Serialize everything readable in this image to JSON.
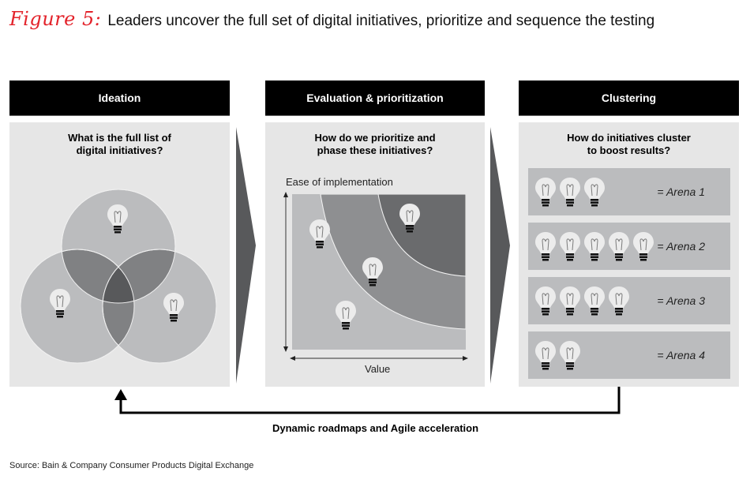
{
  "title": {
    "figure_label": "Figure 5:",
    "text": "Leaders uncover the full set of digital initiatives, prioritize and sequence the testing"
  },
  "colors": {
    "accent_red": "#e3232b",
    "header_bg": "#000000",
    "panel_bg": "#e6e6e6",
    "light_gray": "#bbbcbe",
    "mid_gray": "#8e8f91",
    "dark_gray": "#6a6b6d",
    "darkest_gray": "#58595b",
    "chevron": "#58595b"
  },
  "stages": [
    {
      "header": "Ideation",
      "question_lines": [
        "What is the full list of",
        "digital initiatives?"
      ],
      "visual": "venn-diagram",
      "bulb_count": 3
    },
    {
      "header": "Evaluation & prioritization",
      "question_lines": [
        "How do we prioritize and",
        "phase these initiatives?"
      ],
      "visual": "prioritization-matrix",
      "y_axis_label": "Ease of implementation",
      "x_axis_label": "Value",
      "bulb_count": 4
    },
    {
      "header": "Clustering",
      "question_lines": [
        "How do initiatives cluster",
        "to boost results?"
      ],
      "visual": "arena-list",
      "arenas": [
        {
          "label": "= Arena 1",
          "bulbs": 3
        },
        {
          "label": "= Arena 2",
          "bulbs": 5
        },
        {
          "label": "= Arena 3",
          "bulbs": 4
        },
        {
          "label": "= Arena 4",
          "bulbs": 2
        }
      ]
    }
  ],
  "feedback_loop": {
    "label": "Dynamic roadmaps and Agile acceleration",
    "from": "Clustering",
    "to": "Ideation"
  },
  "icons": {
    "bulb": "lightbulb-icon",
    "chevron": "chevron-right-icon",
    "arrow": "arrow-up-icon"
  },
  "source": "Source: Bain & Company Consumer Products Digital Exchange"
}
